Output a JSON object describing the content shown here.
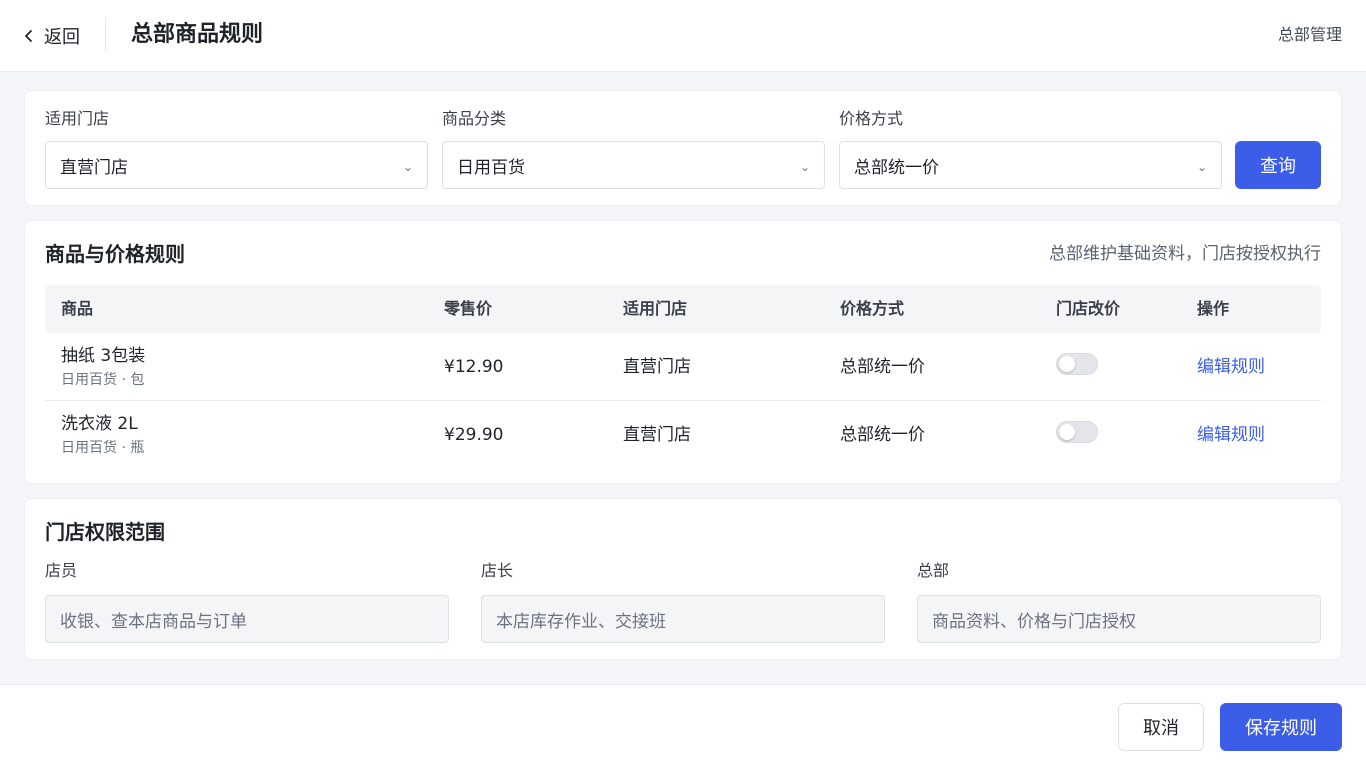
{
  "header": {
    "back_label": "返回",
    "title": "总部商品规则",
    "right_link": "总部管理"
  },
  "filters": {
    "store_label": "适用门店",
    "store_value": "直营门店",
    "category_label": "商品分类",
    "category_value": "日用百货",
    "price_label": "价格方式",
    "price_value": "总部统一价",
    "query_button": "查询"
  },
  "rules": {
    "title": "商品与价格规则",
    "note": "总部维护基础资料，门店按授权执行",
    "columns": [
      "商品",
      "零售价",
      "适用门店",
      "价格方式",
      "门店改价",
      "操作"
    ],
    "rows": [
      {
        "name": "抽纸 3包装",
        "sub": "日用百货 · 包",
        "price": "¥12.90",
        "store": "直营门店",
        "price_mode": "总部统一价",
        "store_price_change": false,
        "action": "编辑规则"
      },
      {
        "name": "洗衣液 2L",
        "sub": "日用百货 · 瓶",
        "price": "¥29.90",
        "store": "直营门店",
        "price_mode": "总部统一价",
        "store_price_change": false,
        "action": "编辑规则"
      }
    ]
  },
  "permissions": {
    "title": "门店权限范围",
    "items": [
      {
        "label": "店员",
        "value": "收银、查本店商品与订单"
      },
      {
        "label": "店长",
        "value": "本店库存作业、交接班"
      },
      {
        "label": "总部",
        "value": "商品资料、价格与门店授权"
      }
    ]
  },
  "footer": {
    "cancel": "取消",
    "save": "保存规则"
  },
  "colors": {
    "accent": "#3b5de7",
    "background": "#f3f5f8"
  }
}
